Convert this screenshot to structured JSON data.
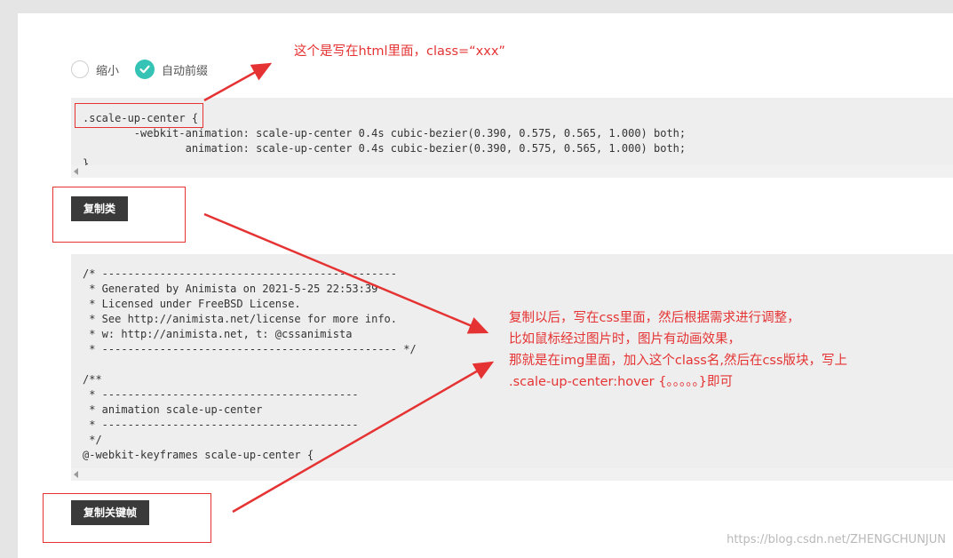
{
  "options": {
    "shrink_label": "缩小",
    "auto_prefix_label": "自动前缀",
    "auto_prefix_checked": true
  },
  "class_code": {
    "lines": [
      ".scale-up-center {",
      "        -webkit-animation: scale-up-center 0.4s cubic-bezier(0.390, 0.575, 0.565, 1.000) both;",
      "                animation: scale-up-center 0.4s cubic-bezier(0.390, 0.575, 0.565, 1.000) both;",
      "}"
    ]
  },
  "keyframes_code": {
    "lines": [
      "/* ----------------------------------------------",
      " * Generated by Animista on 2021-5-25 22:53:39",
      " * Licensed under FreeBSD License.",
      " * See http://animista.net/license for more info.",
      " * w: http://animista.net, t: @cssanimista",
      " * ---------------------------------------------- */",
      "",
      "/**",
      " * ----------------------------------------",
      " * animation scale-up-center",
      " * ----------------------------------------",
      " */",
      "@-webkit-keyframes scale-up-center {"
    ]
  },
  "buttons": {
    "copy_class": "复制类",
    "copy_keyframes": "复制关键帧"
  },
  "annotations": {
    "note_top": "这个是写在html里面，class=“xxx”",
    "note_main": [
      "复制以后，写在css里面，然后根据需求进行调整，",
      "比如鼠标经过图片时，图片有动画效果，",
      "那就是在img里面，加入这个class名,然后在css版块，写上",
      ".scale-up-center:hover {。。。。。}即可"
    ],
    "color": "#e53333"
  },
  "watermark": "https://blog.csdn.net/ZHENGCHUNJUN",
  "colors": {
    "accent": "#35c3b5",
    "button_bg": "#3a3a3a",
    "code_bg": "#eeeeee"
  }
}
